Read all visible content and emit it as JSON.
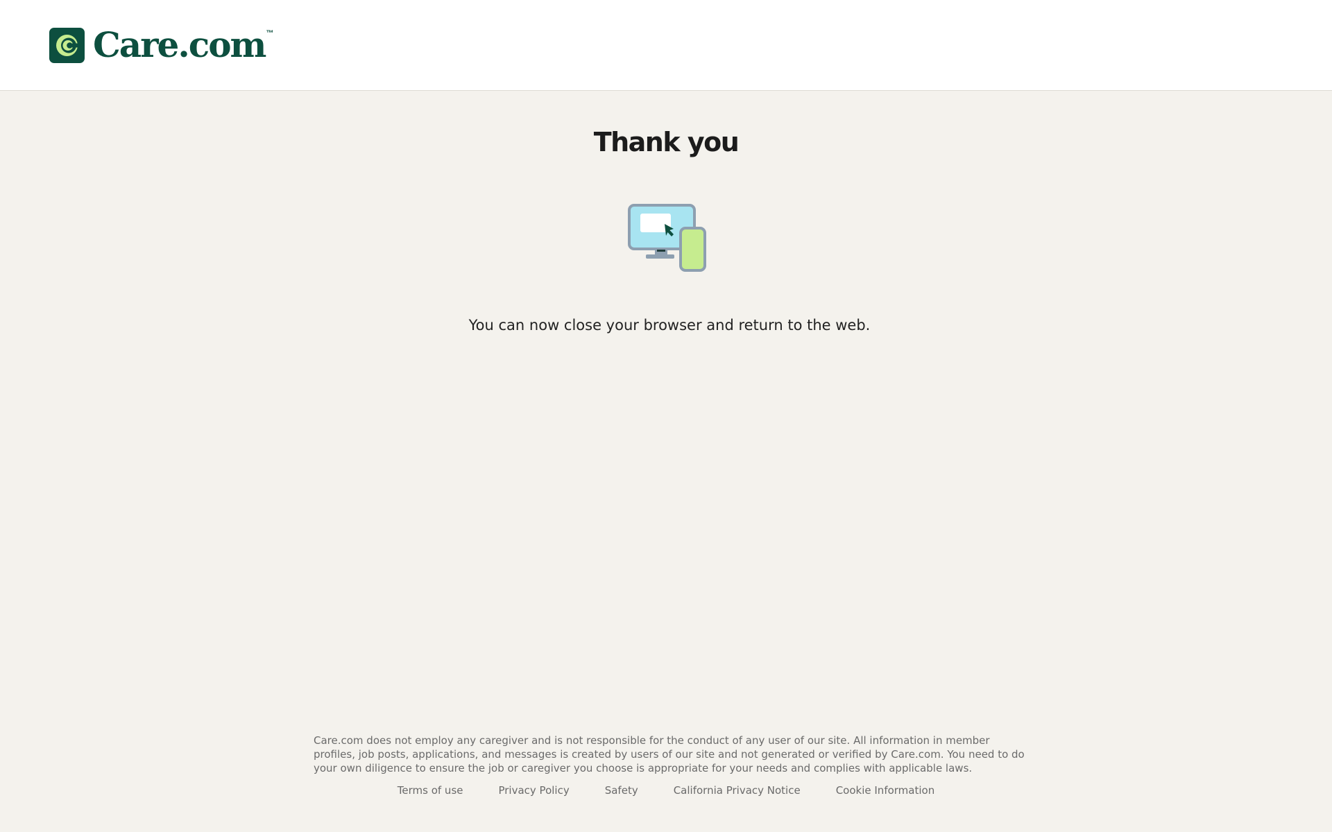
{
  "header": {
    "logo_text": "Care.com",
    "logo_tm": "™",
    "logo_icon": "care-c-logo-icon"
  },
  "main": {
    "title": "Thank you",
    "illustration": "devices-icon",
    "message": "You can now close your browser and return to the web."
  },
  "footer": {
    "disclaimer": "Care.com does not employ any caregiver and is not responsible for the conduct of any user of our site. All information in member profiles, job posts, applications, and messages is created by users of our site and not generated or verified by Care.com. You need to do your own diligence to ensure the job or caregiver you choose is appropriate for your needs and complies with applicable laws.",
    "links": [
      {
        "label": "Terms of use"
      },
      {
        "label": "Privacy Policy"
      },
      {
        "label": "Safety"
      },
      {
        "label": "California Privacy Notice"
      },
      {
        "label": "Cookie Information"
      }
    ]
  },
  "colors": {
    "brand": "#0d4f3f",
    "brand_accent": "#c6ec8f",
    "page_background": "#f4f2ed",
    "header_background": "#ffffff"
  }
}
